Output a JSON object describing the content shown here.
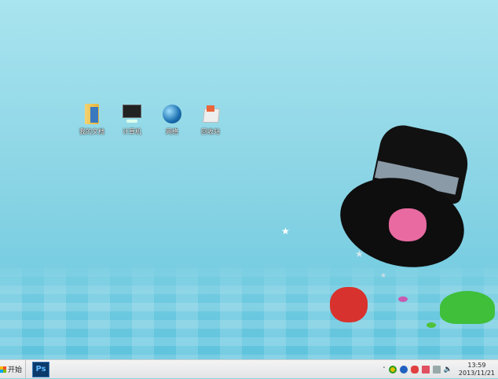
{
  "desktop": {
    "icons": [
      {
        "label": "我的文档",
        "icon": "folder-icon"
      },
      {
        "label": "计算机",
        "icon": "computer-icon"
      },
      {
        "label": "网络",
        "icon": "network-globe-icon"
      },
      {
        "label": "回收站",
        "icon": "recycle-bin-icon"
      }
    ]
  },
  "taskbar": {
    "start_label": "开始",
    "ps_label": "Ps",
    "clock_time": "13:59",
    "clock_date": "2013/11/21"
  },
  "colors": {
    "taskbar": "#e8e9ea",
    "sky": "#a9e4ef"
  }
}
